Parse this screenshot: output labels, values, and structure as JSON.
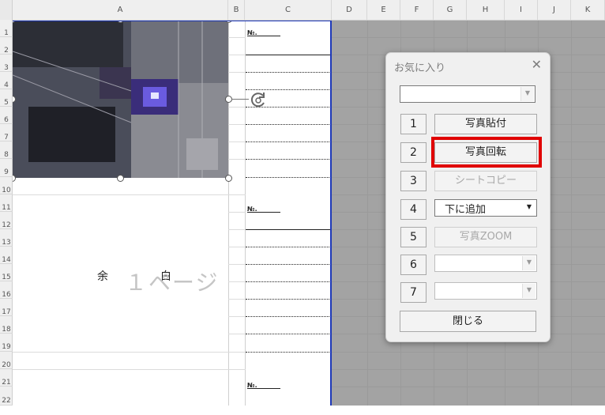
{
  "spreadsheet": {
    "column_headers": [
      "A",
      "B",
      "C",
      "D",
      "E",
      "F",
      "G",
      "H",
      "I",
      "J",
      "K"
    ],
    "row_headers": [
      "1",
      "2",
      "3",
      "4",
      "5",
      "6",
      "7",
      "8",
      "9",
      "10",
      "11",
      "12",
      "13",
      "14",
      "15",
      "16",
      "17",
      "18",
      "19",
      "20",
      "21",
      "22"
    ],
    "no_label": "№.",
    "margin_text": "余　白",
    "page_text": "１ページ"
  },
  "dialog": {
    "title": "お気に入り",
    "close_glyph": "✕",
    "top_combo_value": "",
    "rows": [
      {
        "num": "1",
        "label": "写真貼付",
        "enabled": true
      },
      {
        "num": "2",
        "label": "写真回転",
        "enabled": true
      },
      {
        "num": "3",
        "label": "シートコピー",
        "enabled": false
      },
      {
        "num": "4",
        "label": "下に追加",
        "enabled": true
      },
      {
        "num": "5",
        "label": "写真ZOOM",
        "enabled": false
      },
      {
        "num": "6",
        "label": "",
        "enabled": false
      },
      {
        "num": "7",
        "label": "",
        "enabled": false
      }
    ],
    "close_button_label": "閉じる",
    "highlight_color": "#e00000"
  }
}
